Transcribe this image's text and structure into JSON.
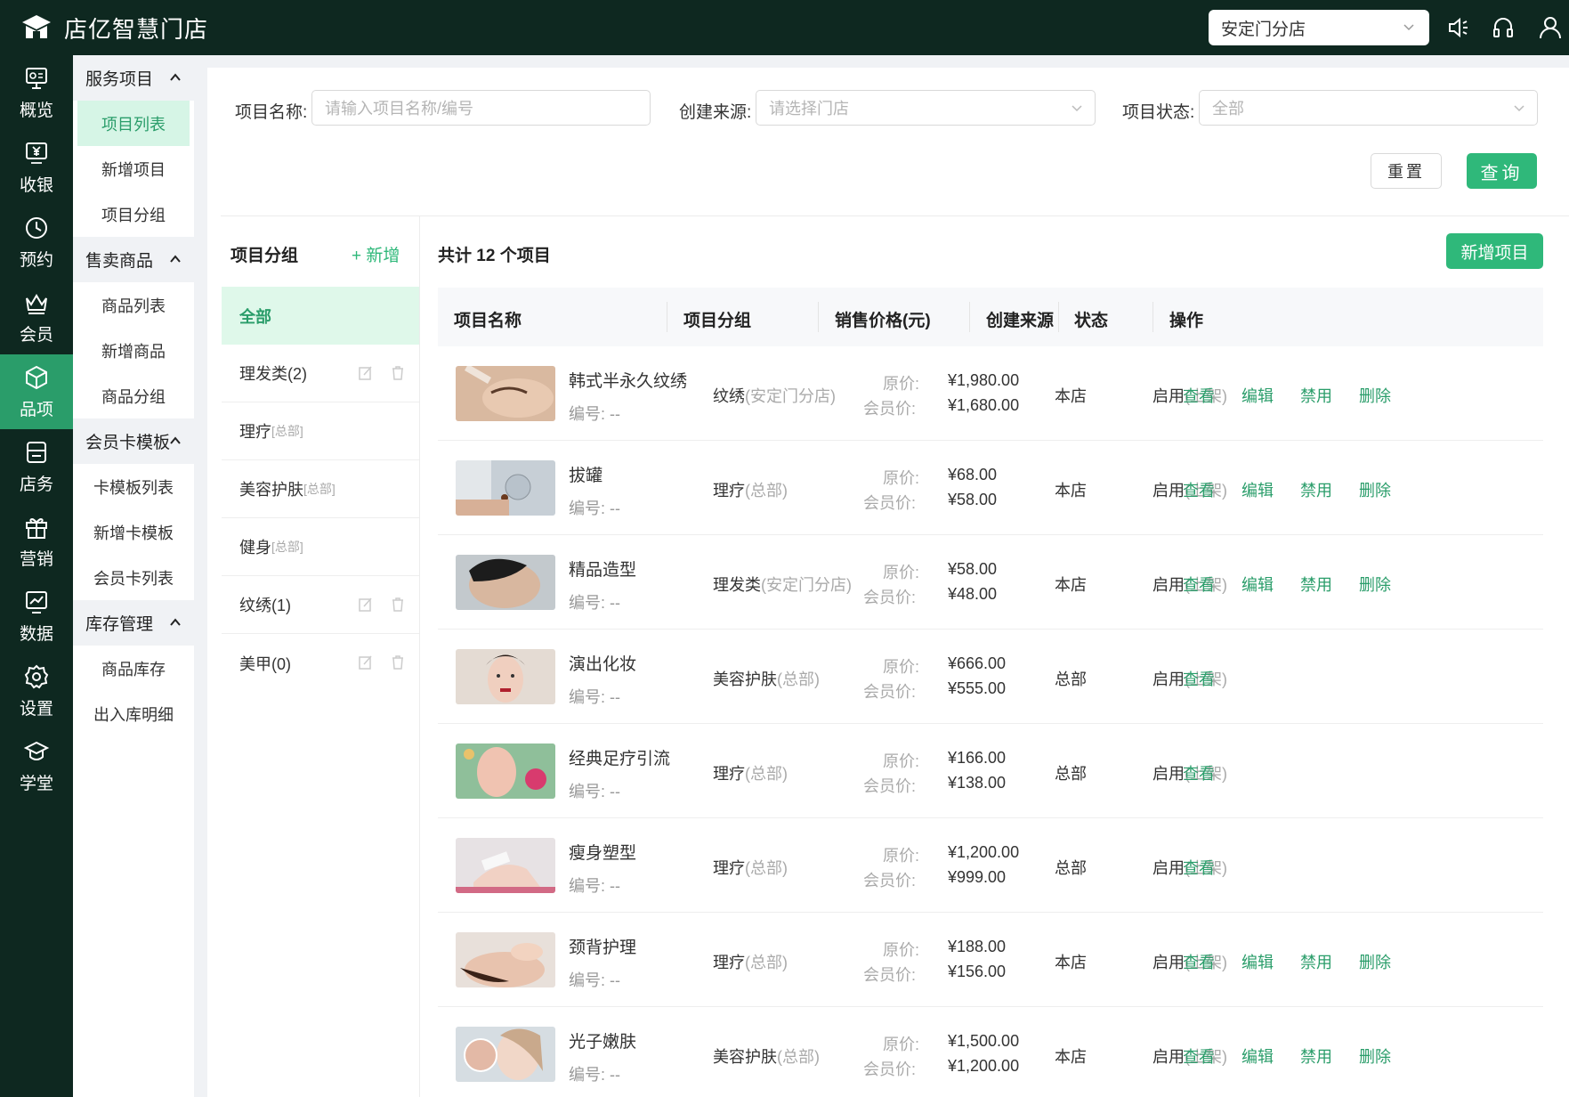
{
  "app": {
    "title": "店亿智慧门店"
  },
  "store": {
    "selected": "安定门分店"
  },
  "rail": [
    {
      "label": "概览",
      "icon": "overview-icon"
    },
    {
      "label": "收银",
      "icon": "cashier-icon"
    },
    {
      "label": "预约",
      "icon": "clock-icon"
    },
    {
      "label": "会员",
      "icon": "crown-icon"
    },
    {
      "label": "品项",
      "icon": "box-icon",
      "active": true
    },
    {
      "label": "店务",
      "icon": "store-task-icon"
    },
    {
      "label": "营销",
      "icon": "gift-icon"
    },
    {
      "label": "数据",
      "icon": "chart-icon"
    },
    {
      "label": "设置",
      "icon": "gear-icon"
    },
    {
      "label": "学堂",
      "icon": "graduation-icon"
    }
  ],
  "submenu": {
    "g1": "服务项目",
    "g1_items": [
      "项目列表",
      "新增项目",
      "项目分组"
    ],
    "g2": "售卖商品",
    "g2_items": [
      "商品列表",
      "新增商品",
      "商品分组"
    ],
    "g3": "会员卡模板",
    "g3_items": [
      "卡模板列表",
      "新增卡模板",
      "会员卡列表"
    ],
    "g4": "库存管理",
    "g4_items": [
      "商品库存",
      "出入库明细"
    ]
  },
  "filters": {
    "name_label": "项目名称:",
    "name_placeholder": "请输入项目名称/编号",
    "source_label": "创建来源:",
    "source_placeholder": "请选择门店",
    "status_label": "项目状态:",
    "status_value": "全部",
    "reset": "重置",
    "query": "查询"
  },
  "groups": {
    "title": "项目分组",
    "add": "+ 新增",
    "items": [
      {
        "name": "全部",
        "tag": ""
      },
      {
        "name": "理发类(2)",
        "tag": ""
      },
      {
        "name": "理疗",
        "tag": "[总部]"
      },
      {
        "name": "美容护肤",
        "tag": "[总部]"
      },
      {
        "name": "健身",
        "tag": "[总部]"
      },
      {
        "name": "纹绣(1)",
        "tag": ""
      },
      {
        "name": "美甲(0)",
        "tag": ""
      }
    ]
  },
  "list": {
    "total": "共计 12 个项目",
    "new_button": "新增项目",
    "headers": [
      "项目名称",
      "项目分组",
      "销售价格(元)",
      "创建来源",
      "状态",
      "操作"
    ],
    "orig_label": "原价:",
    "member_label": "会员价:",
    "code_label": "编号: --",
    "ops": {
      "view": "查看",
      "edit": "编辑",
      "disable": "禁用",
      "delete": "删除"
    }
  },
  "rows": [
    {
      "name": "韩式半永久纹绣",
      "group": "纹绣",
      "group_tag": "(安定门分店)",
      "orig": "¥1,980.00",
      "member": "¥1,680.00",
      "source": "本店",
      "status": "启用",
      "status_tag": "(上架)",
      "full_ops": true
    },
    {
      "name": "拔罐",
      "group": "理疗",
      "group_tag": "(总部)",
      "orig": "¥68.00",
      "member": "¥58.00",
      "source": "本店",
      "status": "启用",
      "status_tag": "(上架)",
      "full_ops": true
    },
    {
      "name": "精品造型",
      "group": "理发类",
      "group_tag": "(安定门分店)",
      "orig": "¥58.00",
      "member": "¥48.00",
      "source": "本店",
      "status": "启用",
      "status_tag": "(上架)",
      "full_ops": true
    },
    {
      "name": "演出化妆",
      "group": "美容护肤",
      "group_tag": "(总部)",
      "orig": "¥666.00",
      "member": "¥555.00",
      "source": "总部",
      "status": "启用",
      "status_tag": "(上架)",
      "full_ops": false
    },
    {
      "name": "经典足疗引流",
      "group": "理疗",
      "group_tag": "(总部)",
      "orig": "¥166.00",
      "member": "¥138.00",
      "source": "总部",
      "status": "启用",
      "status_tag": "(上架)",
      "full_ops": false
    },
    {
      "name": "瘦身塑型",
      "group": "理疗",
      "group_tag": "(总部)",
      "orig": "¥1,200.00",
      "member": "¥999.00",
      "source": "总部",
      "status": "启用",
      "status_tag": "(上架)",
      "full_ops": false
    },
    {
      "name": "颈背护理",
      "group": "理疗",
      "group_tag": "(总部)",
      "orig": "¥188.00",
      "member": "¥156.00",
      "source": "本店",
      "status": "启用",
      "status_tag": "(上架)",
      "full_ops": true
    },
    {
      "name": "光子嫩肤",
      "group": "美容护肤",
      "group_tag": "(总部)",
      "orig": "¥1,500.00",
      "member": "¥1,200.00",
      "source": "本店",
      "status": "启用",
      "status_tag": "(上架)",
      "full_ops": true
    }
  ],
  "colors": {
    "brand": "#2fb87a",
    "dark": "#0e2820",
    "active_rail": "#2a9d6a"
  }
}
